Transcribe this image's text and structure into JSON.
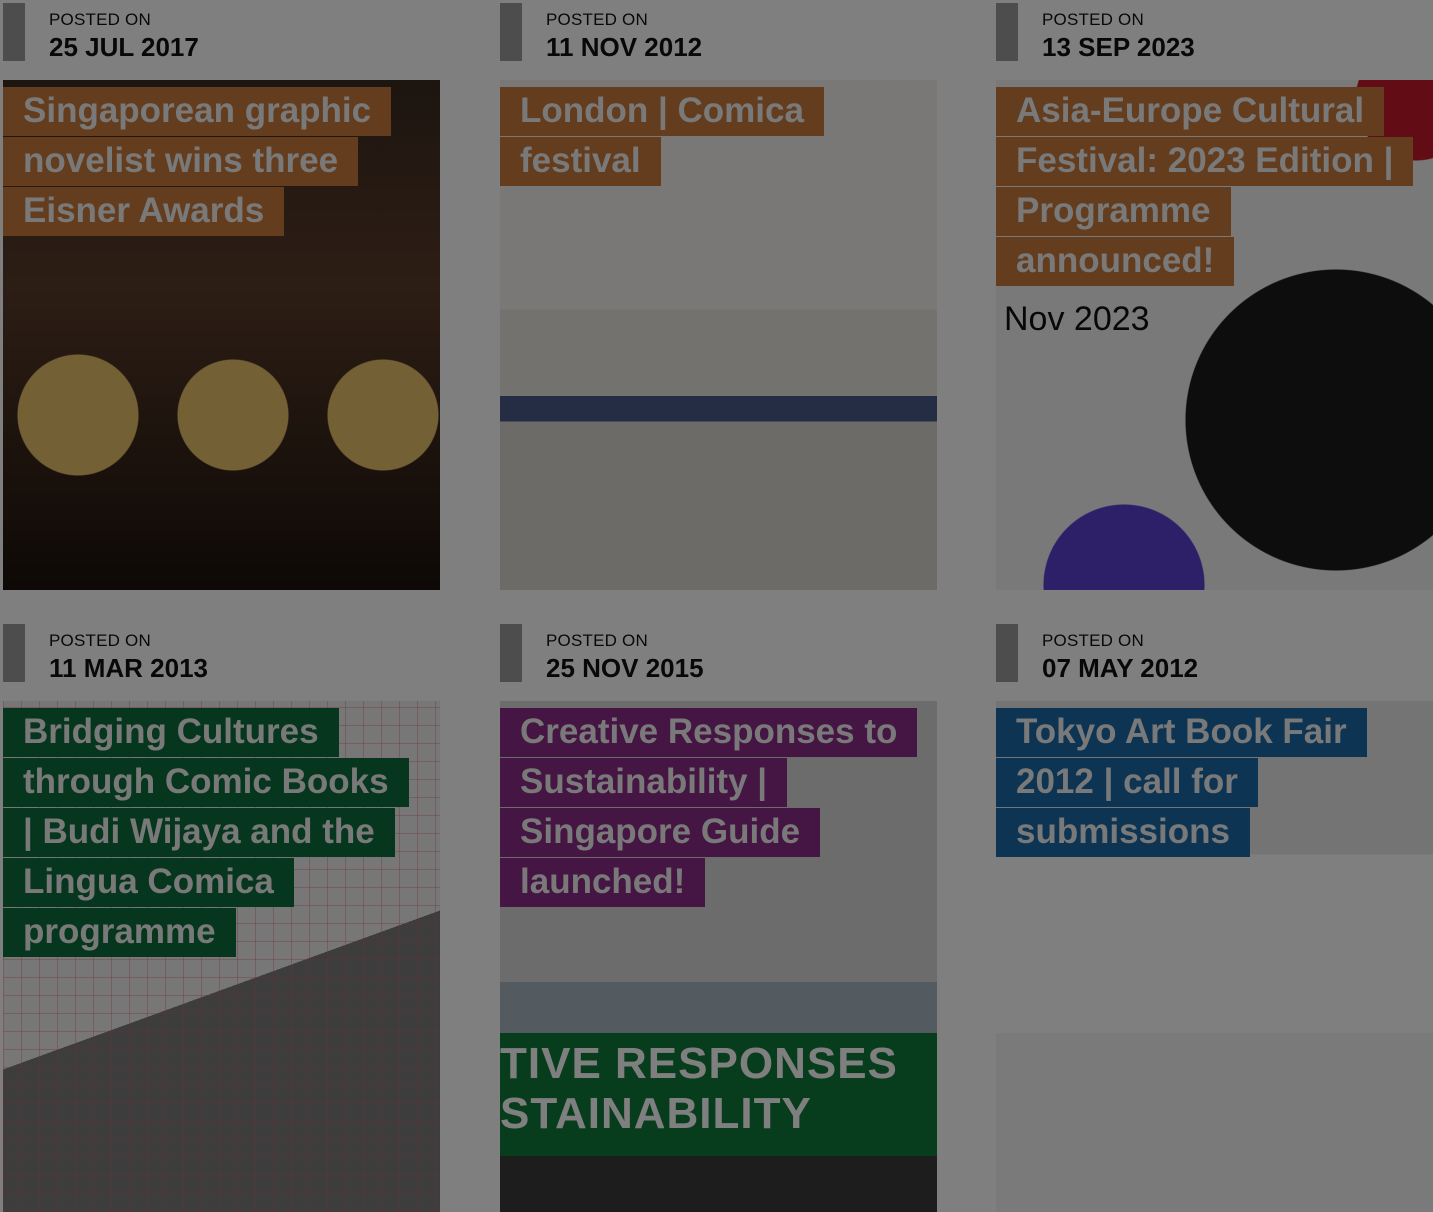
{
  "posts": [
    {
      "posted_label": "POSTED ON",
      "date": "25 JUL 2017",
      "title": "Singaporean graphic novelist wins three Eisner Awards",
      "accent": "#c87a3c",
      "image_icon": "photo-icon"
    },
    {
      "posted_label": "POSTED ON",
      "date": "11 NOV 2012",
      "title": "London | Comica festival",
      "accent": "#c87a3c",
      "image_icon": "photo-icon"
    },
    {
      "posted_label": "POSTED ON",
      "date": "13 SEP 2023",
      "title": "Asia-Europe Cultural Festival: 2023 Edition | Programme announced!",
      "accent": "#c87a3c",
      "image_icon": "photo-icon",
      "image_text": "Nov 2023"
    },
    {
      "posted_label": "POSTED ON",
      "date": "11 MAR 2013",
      "title": "Bridging Cultures through Comic Books | Budi Wijaya and the Lingua Comica programme",
      "accent": "#0c6e3c",
      "image_icon": "photo-icon"
    },
    {
      "posted_label": "POSTED ON",
      "date": "25 NOV 2015",
      "title": "Creative Responses to Sustainability | Singapore Guide launched!",
      "accent": "#8a2a86",
      "image_icon": "photo-icon",
      "image_text_line1": "TIVE RESPONSES",
      "image_text_line2": "STAINABILITY"
    },
    {
      "posted_label": "POSTED ON",
      "date": "07 MAY 2012",
      "title": "Tokyo Art Book Fair 2012 | call for submissions",
      "accent": "#1a6aa6",
      "image_icon": "photo-icon"
    }
  ]
}
